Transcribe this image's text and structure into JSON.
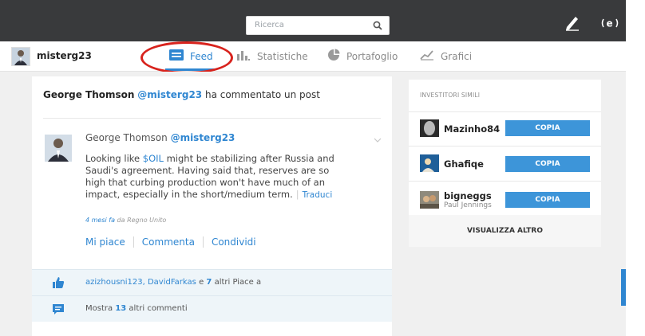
{
  "search": {
    "placeholder": "Ricerca"
  },
  "user": {
    "username": "misterg23"
  },
  "tabs": [
    {
      "label": "Feed",
      "active": true,
      "icon": "feed-icon"
    },
    {
      "label": "Statistiche",
      "active": false,
      "icon": "bar-chart-icon"
    },
    {
      "label": "Portafoglio",
      "active": false,
      "icon": "pie-chart-icon"
    },
    {
      "label": "Grafici",
      "active": false,
      "icon": "line-chart-icon"
    }
  ],
  "feed": {
    "notice": {
      "actor": "George Thomson",
      "handle": "@misterg23",
      "action": "ha commentato un post"
    },
    "post": {
      "author": "George Thomson",
      "handle": "@misterg23",
      "text_before": "Looking like ",
      "ticker": "$OIL",
      "text_after": " might be stabilizing after Russia and Saudi's agreement. Having said that, reserves are so high that curbing production won't have much of an impact, especially in the short/medium term.",
      "translate": "Traduci",
      "time_ago": "4 mesi fa",
      "location": "da Regno Unito",
      "actions": [
        "Mi piace",
        "Commenta",
        "Condividi"
      ]
    },
    "likes": {
      "users": "azizhousni123, DavidFarkas",
      "middle": "e",
      "count": "7",
      "suffix": "altri Piace a"
    },
    "comments": {
      "prefix": "Mostra",
      "count": "13",
      "suffix": "altri commenti"
    }
  },
  "similar": {
    "title": "INVESTITORI SIMILI",
    "investors": [
      {
        "name": "Mazinho84",
        "subtitle": "",
        "button": "COPIA"
      },
      {
        "name": "Ghafiqe",
        "subtitle": "",
        "button": "COPIA"
      },
      {
        "name": "bigneggs",
        "subtitle": "Paul Jennings",
        "button": "COPIA"
      }
    ],
    "more": "VISUALIZZA ALTRO"
  },
  "colors": {
    "accent": "#2f86d1",
    "topbar": "#393a3c",
    "highlight": "#d8231d",
    "copy_button": "#3d95d9"
  }
}
